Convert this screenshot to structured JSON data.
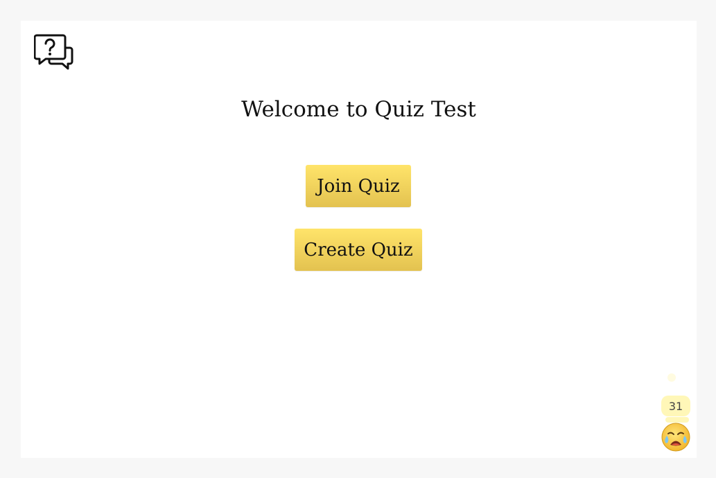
{
  "app": {
    "logo_icon": "question-chat-bubbles-icon"
  },
  "main": {
    "title": "Welcome to Quiz Test",
    "join_label": "Join Quiz",
    "create_label": "Create Quiz"
  },
  "reaction_widget": {
    "count": "31",
    "icon": "crying-face-icon"
  },
  "colors": {
    "button_top": "#ffe46a",
    "button_bottom": "#e3c250",
    "page_bg": "#f7f7f7",
    "card_bg": "#ffffff"
  }
}
